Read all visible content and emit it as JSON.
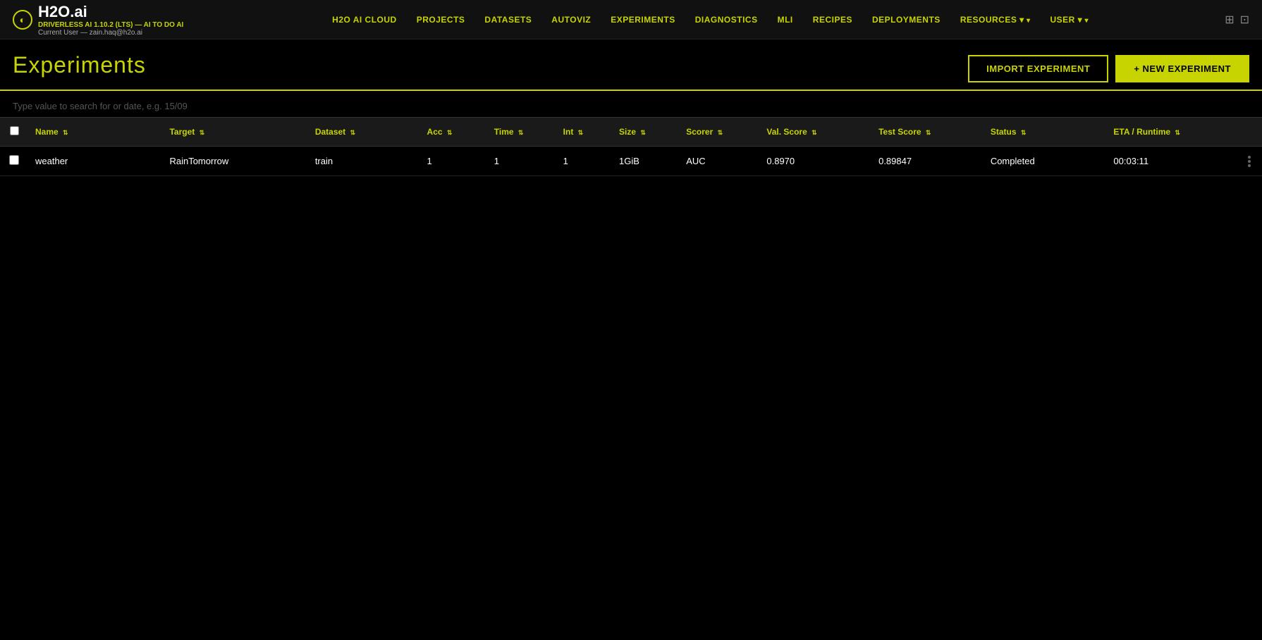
{
  "app": {
    "logo_icon": "◐",
    "logo_text": "H2O.ai",
    "version_line1": "DRIVERLESS AI 1.10.2 (LTS) — AI TO DO AI",
    "version_line2": "Current User — zain.haq@h2o.ai"
  },
  "nav": {
    "links": [
      {
        "label": "H2O AI CLOUD",
        "key": "h2o-ai-cloud",
        "has_arrow": false
      },
      {
        "label": "PROJECTS",
        "key": "projects",
        "has_arrow": false
      },
      {
        "label": "DATASETS",
        "key": "datasets",
        "has_arrow": false
      },
      {
        "label": "AUTOVIZ",
        "key": "autoviz",
        "has_arrow": false
      },
      {
        "label": "EXPERIMENTS",
        "key": "experiments",
        "has_arrow": false
      },
      {
        "label": "DIAGNOSTICS",
        "key": "diagnostics",
        "has_arrow": false
      },
      {
        "label": "MLI",
        "key": "mli",
        "has_arrow": false
      },
      {
        "label": "RECIPES",
        "key": "recipes",
        "has_arrow": false
      },
      {
        "label": "DEPLOYMENTS",
        "key": "deployments",
        "has_arrow": false
      },
      {
        "label": "RESOURCES",
        "key": "resources",
        "has_arrow": true
      },
      {
        "label": "USER",
        "key": "user",
        "has_arrow": true
      }
    ]
  },
  "page": {
    "title": "Experiments",
    "import_button": "IMPORT EXPERIMENT",
    "new_button": "+ NEW EXPERIMENT"
  },
  "search": {
    "placeholder": "Type value to search for or date, e.g. 15/09"
  },
  "table": {
    "columns": [
      {
        "label": "Name",
        "key": "name",
        "sortable": true
      },
      {
        "label": "Target",
        "key": "target",
        "sortable": true
      },
      {
        "label": "Dataset",
        "key": "dataset",
        "sortable": true
      },
      {
        "label": "Acc",
        "key": "acc",
        "sortable": true
      },
      {
        "label": "Time",
        "key": "time",
        "sortable": true
      },
      {
        "label": "Int",
        "key": "int",
        "sortable": true
      },
      {
        "label": "Size",
        "key": "size",
        "sortable": true
      },
      {
        "label": "Scorer",
        "key": "scorer",
        "sortable": true
      },
      {
        "label": "Val. Score",
        "key": "val_score",
        "sortable": true
      },
      {
        "label": "Test Score",
        "key": "test_score",
        "sortable": true
      },
      {
        "label": "Status",
        "key": "status",
        "sortable": true
      },
      {
        "label": "ETA / Runtime",
        "key": "eta_runtime",
        "sortable": true
      }
    ],
    "rows": [
      {
        "name": "weather",
        "target": "RainTomorrow",
        "dataset": "train",
        "acc": "1",
        "time": "1",
        "int": "1",
        "size": "1GiB",
        "scorer": "AUC",
        "val_score": "0.8970",
        "test_score": "0.89847",
        "status": "Completed",
        "eta_runtime": "00:03:11"
      }
    ]
  }
}
